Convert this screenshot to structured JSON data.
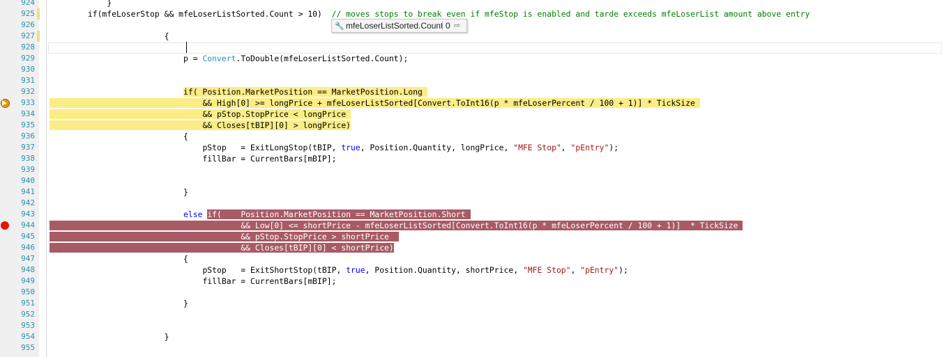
{
  "editor": {
    "line_numbers": [
      "924",
      "925",
      "926",
      "927",
      "928",
      "929",
      "930",
      "931",
      "932",
      "933",
      "934",
      "935",
      "936",
      "937",
      "938",
      "939",
      "940",
      "941",
      "942",
      "943",
      "944",
      "945",
      "946",
      "947",
      "948",
      "949",
      "950",
      "951",
      "952",
      "953",
      "954",
      "955"
    ],
    "lines": [
      [
        {
          "t": "            }"
        }
      ],
      [
        {
          "t": "        if(mfeLoserStop && mfeLoserListSorted.Count > 10)  "
        },
        {
          "t": "// moves stops to break even if mfeStop is enabled and tarde exceeds mfeLoserList amount above entry",
          "c": "cmt"
        }
      ],
      [],
      [
        {
          "t": "                        {"
        }
      ],
      [],
      [
        {
          "t": "                            p = "
        },
        {
          "t": "Convert",
          "c": "ty"
        },
        {
          "t": ".ToDouble(mfeLoserListSorted.Count);"
        }
      ],
      [],
      [],
      [
        {
          "t": "                            "
        },
        {
          "t": "if( Position.MarketPosition == MarketPosition.Long ",
          "c": "hl-y"
        }
      ],
      [
        {
          "t": "  ",
          "c": "hl-y"
        },
        {
          "t": "                              && High[0] >= longPrice + mfeLoserListSorted[Convert.ToInt16(p * mfeLoserPercent / 100 + 1)] * TickSize ",
          "c": "hl-y"
        }
      ],
      [
        {
          "t": "  ",
          "c": "hl-y"
        },
        {
          "t": "                              && pStop.StopPrice < longPrice ",
          "c": "hl-y"
        }
      ],
      [
        {
          "t": "  ",
          "c": "hl-y"
        },
        {
          "t": "                              && Closes[tBIP][0] > longPrice)",
          "c": "hl-y"
        }
      ],
      [
        {
          "t": "                            {"
        }
      ],
      [
        {
          "t": "                                pStop   = ExitLongStop(tBIP, "
        },
        {
          "t": "true",
          "c": "kw"
        },
        {
          "t": ", Position.Quantity, longPrice, "
        },
        {
          "t": "\"MFE Stop\"",
          "c": "str"
        },
        {
          "t": ", "
        },
        {
          "t": "\"pEntry\"",
          "c": "str"
        },
        {
          "t": ");"
        }
      ],
      [
        {
          "t": "                                fillBar = CurrentBars[mBIP];"
        }
      ],
      [],
      [],
      [
        {
          "t": "                            }"
        }
      ],
      [],
      [
        {
          "t": "                            "
        },
        {
          "t": "else",
          "c": "kw"
        },
        {
          "t": " "
        },
        {
          "t": "if(    Position.MarketPosition == MarketPosition.Short ",
          "c": "hl-r"
        }
      ],
      [
        {
          "t": "  ",
          "c": "hl-r"
        },
        {
          "t": "                                      && Low[0] <= shortPrice - mfeLoserListSorted[Convert.ToInt16(p * mfeLoserPercent / 100 + 1)]  * TickSize ",
          "c": "hl-r"
        }
      ],
      [
        {
          "t": "  ",
          "c": "hl-r"
        },
        {
          "t": "                                      && pStop.StopPrice > shortPrice  ",
          "c": "hl-r"
        }
      ],
      [
        {
          "t": "  ",
          "c": "hl-r"
        },
        {
          "t": "                                      && Closes[tBIP][0] < shortPrice)",
          "c": "hl-r"
        }
      ],
      [
        {
          "t": "                            {"
        }
      ],
      [
        {
          "t": "                                pStop   = ExitShortStop(tBIP, "
        },
        {
          "t": "true",
          "c": "kw"
        },
        {
          "t": ", Position.Quantity, shortPrice, "
        },
        {
          "t": "\"MFE Stop\"",
          "c": "str"
        },
        {
          "t": ", "
        },
        {
          "t": "\"pEntry\"",
          "c": "str"
        },
        {
          "t": ");"
        }
      ],
      [
        {
          "t": "                                fillBar = CurrentBars[mBIP];"
        }
      ],
      [],
      [
        {
          "t": "                            }"
        }
      ],
      [],
      [],
      [
        {
          "t": "                        }"
        }
      ],
      []
    ],
    "changed_lines": [
      1,
      3
    ],
    "breakpoints": [
      {
        "line": 9,
        "current": true
      },
      {
        "line": 20,
        "current": false
      }
    ],
    "colors": {
      "gutter": "#f0f0f0",
      "line_number": "#2b91af",
      "yellow_highlight": "#fbed86",
      "red_highlight": "#a85b64",
      "keyword": "#0000ff",
      "type": "#2b91af",
      "string": "#a31515",
      "comment": "#008000"
    }
  },
  "tooltip": {
    "icon": "wrench-icon",
    "expression": "mfeLoserListSorted.Count",
    "value": "0",
    "pin_icon": "pin-icon"
  }
}
